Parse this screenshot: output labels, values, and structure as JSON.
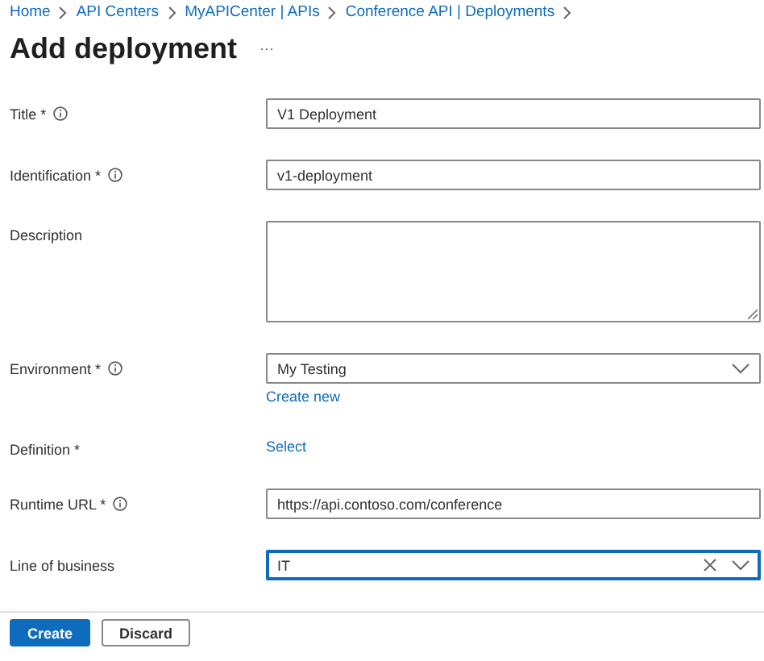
{
  "breadcrumb": [
    "Home",
    "API Centers",
    "MyAPICenter | APIs",
    "Conference API | Deployments"
  ],
  "title": "Add deployment",
  "more": "···",
  "fields": [
    {
      "label": "Title *",
      "info": true,
      "kind": "text",
      "value": "V1 Deployment",
      "focused": false
    },
    {
      "label": "Identification *",
      "info": true,
      "kind": "text",
      "value": "v1-deployment",
      "focused": false
    },
    {
      "label": "Description",
      "info": false,
      "kind": "textarea",
      "focused": false
    },
    {
      "label": "Environment *",
      "info": true,
      "kind": "select",
      "value": "My Testing",
      "link": "Create new",
      "focused": false
    },
    {
      "label": "Definition *",
      "info": false,
      "kind": "link",
      "link": "Select"
    },
    {
      "label": "Runtime URL *",
      "info": true,
      "kind": "text",
      "value": "https://api.contoso.com/conference",
      "focused": false
    },
    {
      "label": "Line of business",
      "info": false,
      "kind": "combo",
      "value": "IT",
      "focused": true
    }
  ],
  "buttons": [
    {
      "label": "Create",
      "kind": "primary"
    },
    {
      "label": "Discard",
      "kind": "secondary"
    }
  ]
}
